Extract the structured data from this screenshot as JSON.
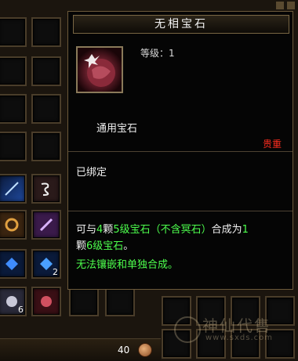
{
  "tooltip": {
    "title": "无相宝石",
    "level": "等级：1",
    "type": "通用宝石",
    "rarity": "贵重",
    "bind_status": "已绑定",
    "desc_prefix": "可与",
    "desc_count": "4",
    "desc_mid1": "颗",
    "desc_gem_level": "5级宝石（不含冥石）",
    "desc_mid2": "合成为",
    "desc_result_count": "1",
    "desc_line2_prefix": "颗",
    "desc_result_level": "6级宝石",
    "desc_line2_suffix": "。",
    "note": "无法镶嵌和单独合成。"
  },
  "bag": {
    "stack_counts": [
      "2",
      "6"
    ],
    "gold_value": "40"
  },
  "watermark": {
    "logo_text": "神仙代售",
    "url": "www.sxds.com"
  },
  "colors": {
    "rarity": "#ff2d1f",
    "highlight": "#4dff4d",
    "border": "#6c5a3b"
  }
}
